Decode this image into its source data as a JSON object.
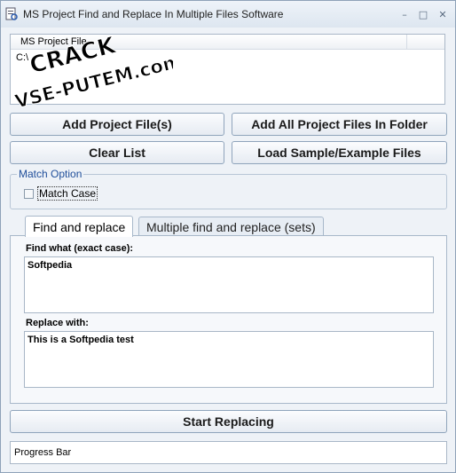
{
  "window": {
    "title": "MS Project Find and Replace In Multiple Files Software",
    "controls": {
      "minimize": "–",
      "maximize": "□",
      "close": "✕"
    }
  },
  "file_list": {
    "column_header": "MS Project File",
    "rows": [
      "C:\\"
    ]
  },
  "buttons": {
    "add_project_files": "Add Project File(s)",
    "add_all_in_folder": "Add All Project Files In Folder",
    "clear_list": "Clear List",
    "load_sample": "Load Sample/Example Files",
    "start_replacing": "Start Replacing"
  },
  "match_option": {
    "legend": "Match Option",
    "match_case_label": "Match Case",
    "match_case_checked": false
  },
  "tabs": [
    {
      "label": "Find and replace",
      "active": true
    },
    {
      "label": "Multiple find and replace (sets)",
      "active": false
    }
  ],
  "find_replace": {
    "find_label": "Find what (exact case):",
    "find_value": "Softpedia",
    "replace_label": "Replace with:",
    "replace_value": "This is a Softpedia test"
  },
  "progress": {
    "label": "Progress Bar"
  },
  "watermark": {
    "line1": "CRACK",
    "line2": "VSE-PUTEM.com"
  }
}
